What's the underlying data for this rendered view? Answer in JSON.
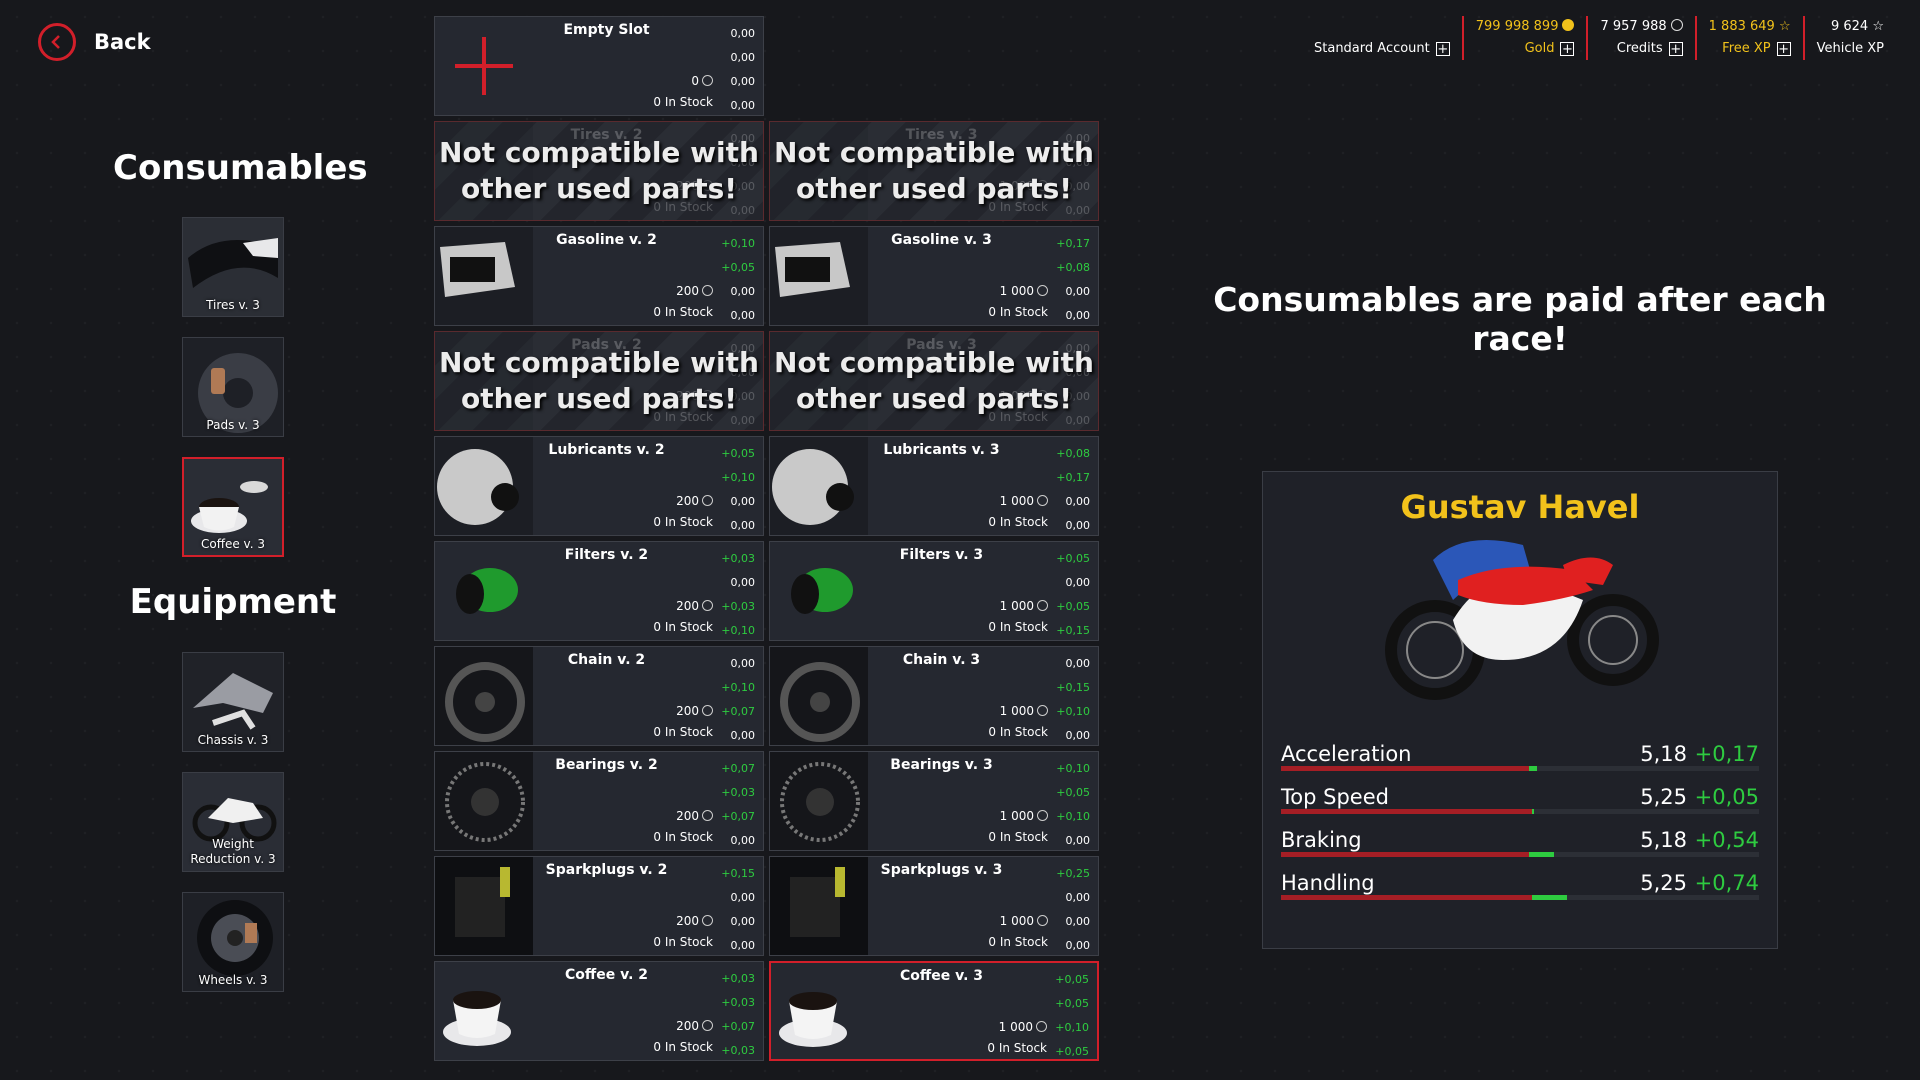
{
  "back": {
    "label": "Back"
  },
  "header": {
    "account": {
      "label": "Standard Account"
    },
    "gold": {
      "value": "799 998 899",
      "label": "Gold"
    },
    "credits": {
      "value": "7 957 988",
      "label": "Credits"
    },
    "free_xp": {
      "value": "1 883 649",
      "label": "Free XP"
    },
    "vehicle_xp": {
      "value": "9 624",
      "label": "Vehicle XP"
    }
  },
  "sidebar": {
    "consumables_title": "Consumables",
    "equipment_title": "Equipment",
    "consumables": [
      {
        "label": "Tires v. 3",
        "icon": "tire-icon"
      },
      {
        "label": "Pads v. 3",
        "icon": "brake-pad-icon"
      },
      {
        "label": "Coffee v. 3",
        "icon": "coffee-icon",
        "selected": true
      }
    ],
    "equipment": [
      {
        "label": "Chassis v. 3",
        "icon": "chassis-icon"
      },
      {
        "label": "Weight Reduction v. 3",
        "icon": "weight-reduction-icon"
      },
      {
        "label": "Wheels v. 3",
        "icon": "wheel-icon"
      }
    ]
  },
  "empty_slot": {
    "name": "Empty Slot",
    "stats": [
      "0,00",
      "0,00",
      "0,00"
    ],
    "price": "0",
    "stock": "0 In Stock",
    "stock_stat": "0,00"
  },
  "incompatible_text": "Not compatible with other used parts!",
  "parts": [
    {
      "name": "Tires v. 2",
      "incompatible": true,
      "stats": [
        "0,00",
        "0,00",
        "0,00"
      ],
      "price": "200",
      "stock": "0 In Stock",
      "stock_stat": "0,00"
    },
    {
      "name": "Tires v. 3",
      "incompatible": true,
      "stats": [
        "0,00",
        "0,00",
        "0,00"
      ],
      "price": "1 000",
      "stock": "0 In Stock",
      "stock_stat": "0,00"
    },
    {
      "name": "Gasoline v. 2",
      "stats": [
        "+0,10",
        "+0,05",
        "0,00"
      ],
      "price": "200",
      "stock": "0 In Stock",
      "stock_stat": "0,00"
    },
    {
      "name": "Gasoline v. 3",
      "stats": [
        "+0,17",
        "+0,08",
        "0,00"
      ],
      "price": "1 000",
      "stock": "0 In Stock",
      "stock_stat": "0,00"
    },
    {
      "name": "Pads v. 2",
      "incompatible": true,
      "stats": [
        "0,00",
        "0,00",
        "0,00"
      ],
      "price": "200",
      "stock": "0 In Stock",
      "stock_stat": "0,00"
    },
    {
      "name": "Pads v. 3",
      "incompatible": true,
      "stats": [
        "0,00",
        "0,00",
        "0,00"
      ],
      "price": "1 000",
      "stock": "0 In Stock",
      "stock_stat": "0,00"
    },
    {
      "name": "Lubricants v. 2",
      "stats": [
        "+0,05",
        "+0,10",
        "0,00"
      ],
      "price": "200",
      "stock": "0 In Stock",
      "stock_stat": "0,00"
    },
    {
      "name": "Lubricants v. 3",
      "stats": [
        "+0,08",
        "+0,17",
        "0,00"
      ],
      "price": "1 000",
      "stock": "0 In Stock",
      "stock_stat": "0,00"
    },
    {
      "name": "Filters v. 2",
      "stats": [
        "+0,03",
        "0,00",
        "+0,03"
      ],
      "price": "200",
      "stock": "0 In Stock",
      "stock_stat": "+0,10"
    },
    {
      "name": "Filters v. 3",
      "stats": [
        "+0,05",
        "0,00",
        "+0,05"
      ],
      "price": "1 000",
      "stock": "0 In Stock",
      "stock_stat": "+0,15"
    },
    {
      "name": "Chain v. 2",
      "stats": [
        "0,00",
        "+0,10",
        "+0,07"
      ],
      "price": "200",
      "stock": "0 In Stock",
      "stock_stat": "0,00"
    },
    {
      "name": "Chain v. 3",
      "stats": [
        "0,00",
        "+0,15",
        "+0,10"
      ],
      "price": "1 000",
      "stock": "0 In Stock",
      "stock_stat": "0,00"
    },
    {
      "name": "Bearings v. 2",
      "stats": [
        "+0,07",
        "+0,03",
        "+0,07"
      ],
      "price": "200",
      "stock": "0 In Stock",
      "stock_stat": "0,00"
    },
    {
      "name": "Bearings v. 3",
      "stats": [
        "+0,10",
        "+0,05",
        "+0,10"
      ],
      "price": "1 000",
      "stock": "0 In Stock",
      "stock_stat": "0,00"
    },
    {
      "name": "Sparkplugs v. 2",
      "stats": [
        "+0,15",
        "0,00",
        "0,00"
      ],
      "price": "200",
      "stock": "0 In Stock",
      "stock_stat": "0,00"
    },
    {
      "name": "Sparkplugs v. 3",
      "stats": [
        "+0,25",
        "0,00",
        "0,00"
      ],
      "price": "1 000",
      "stock": "0 In Stock",
      "stock_stat": "0,00"
    },
    {
      "name": "Coffee v. 2",
      "stats": [
        "+0,03",
        "+0,03",
        "+0,07"
      ],
      "price": "200",
      "stock": "0 In Stock",
      "stock_stat": "+0,03"
    },
    {
      "name": "Coffee v. 3",
      "selected": true,
      "stats": [
        "+0,05",
        "+0,05",
        "+0,10"
      ],
      "price": "1 000",
      "stock": "0 In Stock",
      "stock_stat": "+0,05"
    }
  ],
  "banner": "Consumables are paid after each race!",
  "rider": {
    "name": "Gustav Havel",
    "stats": [
      {
        "name": "Acceleration",
        "value": "5,18",
        "delta": "+0,17"
      },
      {
        "name": "Top Speed",
        "value": "5,25",
        "delta": "+0,05"
      },
      {
        "name": "Braking",
        "value": "5,18",
        "delta": "+0,54"
      },
      {
        "name": "Handling",
        "value": "5,25",
        "delta": "+0,74"
      }
    ]
  },
  "colors": {
    "accent": "#d21f2a",
    "gold": "#f2c21b",
    "positive": "#2ecc40",
    "background": "#17181c"
  }
}
